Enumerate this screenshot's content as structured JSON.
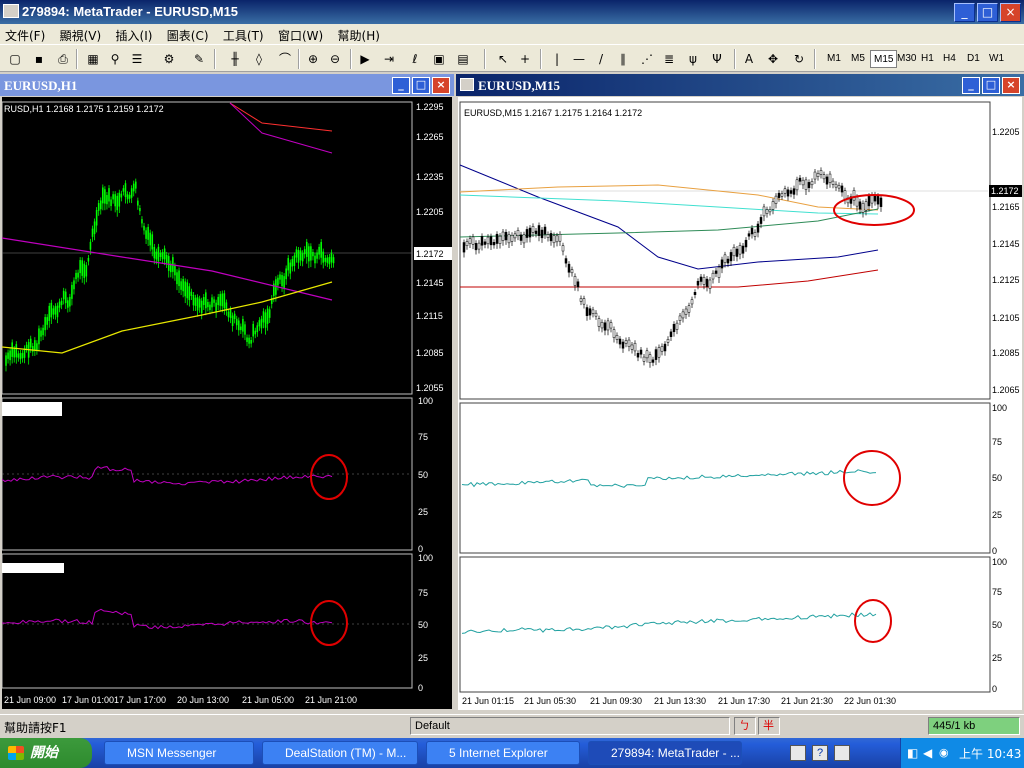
{
  "app": {
    "title": "279894: MetaTrader - EURUSD,M15",
    "minimize": "_",
    "maximize": "□",
    "close": "×"
  },
  "menu": [
    "文件(F)",
    "顯視(V)",
    "插入(I)",
    "圖表(C)",
    "工具(T)",
    "窗口(W)",
    "幫助(H)"
  ],
  "timeframes": [
    "M1",
    "M5",
    "M15",
    "M30",
    "H1",
    "H4",
    "D1",
    "W1"
  ],
  "active_timeframe": "M15",
  "left_window": {
    "title": "EURUSD,H1",
    "info": "RUSD,H1  1.2168 1.2175 1.2159 1.2172",
    "price_ticks": [
      "1.2295",
      "1.2265",
      "1.2235",
      "1.2205",
      "1.2145",
      "1.2115",
      "1.2085",
      "1.2055"
    ],
    "current_price": "1.2172",
    "osc_ticks": [
      "100",
      "75",
      "50",
      "25",
      "0"
    ],
    "time_ticks": [
      "21 Jun 09:00",
      "17 Jun 01:00",
      "17 Jun 17:00",
      "20 Jun 13:00",
      "21 Jun 05:00",
      "21 Jun 21:00"
    ]
  },
  "right_window": {
    "title": "EURUSD,M15",
    "info": "EURUSD,M15  1.2167 1.2175 1.2164 1.2172",
    "price_ticks": [
      "1.2205",
      "1.2165",
      "1.2145",
      "1.2125",
      "1.2105",
      "1.2085",
      "1.2065"
    ],
    "current_price": "1.2172",
    "osc_ticks": [
      "100",
      "75",
      "50",
      "25",
      "0"
    ],
    "time_ticks": [
      "21 Jun 01:15",
      "21 Jun 05:30",
      "21 Jun 09:30",
      "21 Jun 13:30",
      "21 Jun 17:30",
      "21 Jun 21:30",
      "22 Jun 01:30"
    ]
  },
  "status": {
    "help": "幫助請按F1",
    "profile": "Default",
    "ime1": "ㄅ",
    "ime2": "半",
    "traffic": "445/1 kb"
  },
  "taskbar": {
    "start": "開始",
    "tasks": [
      "MSN Messenger",
      "DealStation (TM) - M...",
      "5 Internet Explorer",
      "279894: MetaTrader - ..."
    ],
    "clock": "上午 10:43"
  },
  "colors": {
    "title_blue": "#0a246a",
    "candle_green": "#00ff00",
    "ma_magenta": "#c000c0",
    "ma_yellow": "#e8e800",
    "ma_red": "#c00000",
    "ma_blue": "#00008b",
    "ma_orange": "#e8a040",
    "ma_cyan": "#40e0d0",
    "ma_green": "#2e8b57",
    "osc_teal": "#20a0a0",
    "highlight_circle": "#e00000"
  }
}
